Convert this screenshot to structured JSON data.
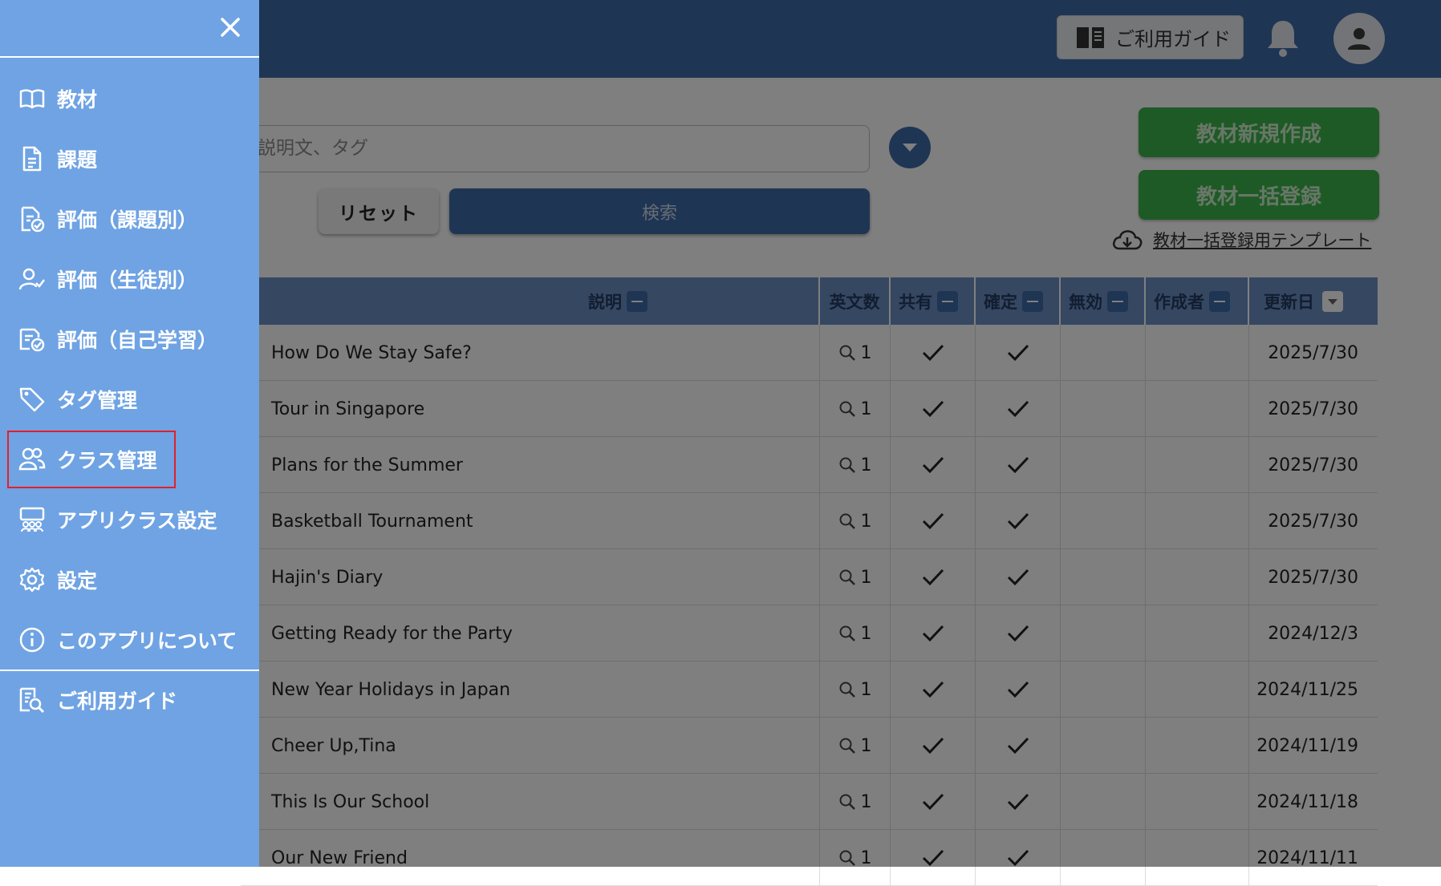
{
  "header": {
    "guide_label": "ご利用ガイド"
  },
  "search": {
    "placeholder": "説明文、タグ",
    "reset_label": "リセット",
    "search_label": "検索"
  },
  "actions": {
    "new_label": "教材新規作成",
    "bulk_label": "教材一括登録",
    "template_label": "教材一括登録用テンプレート"
  },
  "table": {
    "columns": [
      "説明",
      "英文数",
      "共有",
      "確定",
      "無効",
      "作成者",
      "更新日"
    ],
    "rows": [
      {
        "desc": "How Do We Stay Safe?",
        "count": "1",
        "date": "2025/7/30"
      },
      {
        "desc": "Tour in Singapore",
        "count": "1",
        "date": "2025/7/30"
      },
      {
        "desc": "Plans for the Summer",
        "count": "1",
        "date": "2025/7/30"
      },
      {
        "desc": "Basketball Tournament",
        "count": "1",
        "date": "2025/7/30"
      },
      {
        "desc": "Hajin's Diary",
        "count": "1",
        "date": "2025/7/30"
      },
      {
        "desc": "Getting Ready for the Party",
        "count": "1",
        "date": "2024/12/3"
      },
      {
        "desc": "New Year Holidays in Japan",
        "count": "1",
        "date": "2024/11/25"
      },
      {
        "desc": "Cheer Up,Tina",
        "count": "1",
        "date": "2024/11/19"
      },
      {
        "desc": "This Is Our School",
        "count": "1",
        "date": "2024/11/18"
      },
      {
        "desc": "Our New Friend",
        "count": "1",
        "date": "2024/11/11"
      }
    ]
  },
  "drawer": {
    "items": [
      {
        "label": "教材",
        "icon": "book-open-icon"
      },
      {
        "label": "課題",
        "icon": "document-icon"
      },
      {
        "label": "評価（課題別）",
        "icon": "document-check-icon"
      },
      {
        "label": "評価（生徒別）",
        "icon": "user-check-icon"
      },
      {
        "label": "評価（自己学習）",
        "icon": "documents-check-icon"
      },
      {
        "label": "タグ管理",
        "icon": "tag-icon"
      },
      {
        "label": "クラス管理",
        "icon": "users-icon"
      },
      {
        "label": "アプリクラス設定",
        "icon": "group-board-icon"
      },
      {
        "label": "設定",
        "icon": "gear-icon"
      },
      {
        "label": "このアプリについて",
        "icon": "info-icon"
      },
      {
        "label": "ご利用ガイド",
        "icon": "guide-search-icon"
      }
    ]
  },
  "colors": {
    "primary": "#3f6aa8",
    "drawer": "#6fa3e3",
    "green": "#3db54a",
    "highlight": "#e3202a"
  }
}
